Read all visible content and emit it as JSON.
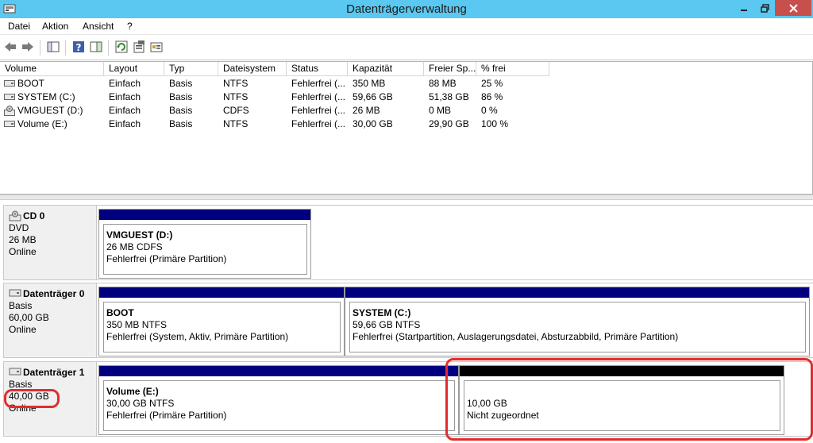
{
  "window": {
    "title": "Datenträgerverwaltung"
  },
  "menu": [
    "Datei",
    "Aktion",
    "Ansicht",
    "?"
  ],
  "columns": [
    "Volume",
    "Layout",
    "Typ",
    "Dateisystem",
    "Status",
    "Kapazität",
    "Freier Sp...",
    "% frei"
  ],
  "volumes": [
    {
      "name": "BOOT",
      "layout": "Einfach",
      "type": "Basis",
      "fs": "NTFS",
      "status": "Fehlerfrei (...",
      "capacity": "350 MB",
      "free": "88 MB",
      "pct": "25 %",
      "icon": "disk-drive-icon"
    },
    {
      "name": "SYSTEM (C:)",
      "layout": "Einfach",
      "type": "Basis",
      "fs": "NTFS",
      "status": "Fehlerfrei (...",
      "capacity": "59,66 GB",
      "free": "51,38 GB",
      "pct": "86 %",
      "icon": "disk-drive-icon"
    },
    {
      "name": "VMGUEST (D:)",
      "layout": "Einfach",
      "type": "Basis",
      "fs": "CDFS",
      "status": "Fehlerfrei (...",
      "capacity": "26 MB",
      "free": "0 MB",
      "pct": "0 %",
      "icon": "cd-drive-icon"
    },
    {
      "name": "Volume (E:)",
      "layout": "Einfach",
      "type": "Basis",
      "fs": "NTFS",
      "status": "Fehlerfrei (...",
      "capacity": "30,00 GB",
      "free": "29,90 GB",
      "pct": "100 %",
      "icon": "disk-drive-icon"
    }
  ],
  "disks": [
    {
      "name": "CD 0",
      "type": "DVD",
      "size": "26 MB",
      "state": "Online",
      "partitions": [
        {
          "name": "VMGUEST  (D:)",
          "info": "26 MB CDFS",
          "status": "Fehlerfrei (Primäre Partition)"
        }
      ]
    },
    {
      "name": "Datenträger 0",
      "type": "Basis",
      "size": "60,00 GB",
      "state": "Online",
      "partitions": [
        {
          "name": "BOOT",
          "info": "350 MB NTFS",
          "status": "Fehlerfrei (System, Aktiv, Primäre Partition)"
        },
        {
          "name": "SYSTEM  (C:)",
          "info": "59,66 GB NTFS",
          "status": "Fehlerfrei (Startpartition, Auslagerungsdatei, Absturzabbild, Primäre Partition)"
        }
      ]
    },
    {
      "name": "Datenträger 1",
      "type": "Basis",
      "size": "40,00 GB",
      "state": "Online",
      "partitions": [
        {
          "name": "Volume  (E:)",
          "info": "30,00 GB NTFS",
          "status": "Fehlerfrei (Primäre Partition)"
        },
        {
          "name": "",
          "info": "10,00 GB",
          "status": "Nicht zugeordnet"
        }
      ]
    }
  ],
  "colors": {
    "titlebar": "#5ac8f0",
    "primary_partition": "#00007f",
    "unallocated": "#000000",
    "annotation": "#e32c2c"
  }
}
